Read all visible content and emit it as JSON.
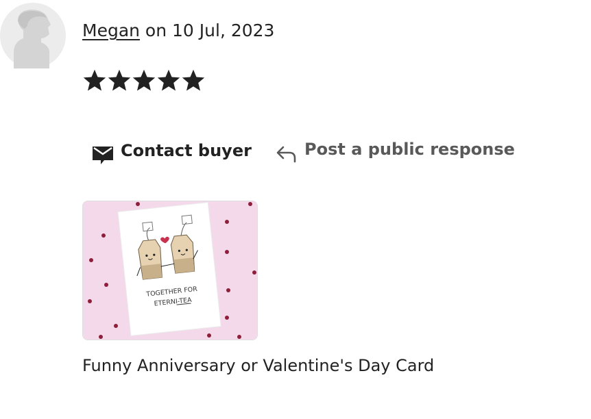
{
  "review": {
    "reviewer_name": "Megan",
    "date_text": " on 10 Jul, 2023",
    "rating": 5,
    "rating_max": 5
  },
  "actions": {
    "contact_label": "Contact buyer",
    "respond_label": "Post a public response"
  },
  "product": {
    "card_line1": "TOGETHER FOR",
    "card_line2": "ETERNI-TEA",
    "title": "Funny Anniversary or Valentine's Day Card"
  },
  "colors": {
    "text": "#222222",
    "muted": "#595959",
    "thumb_bg": "#f3d9e9",
    "heart": "#8e1f3a"
  }
}
